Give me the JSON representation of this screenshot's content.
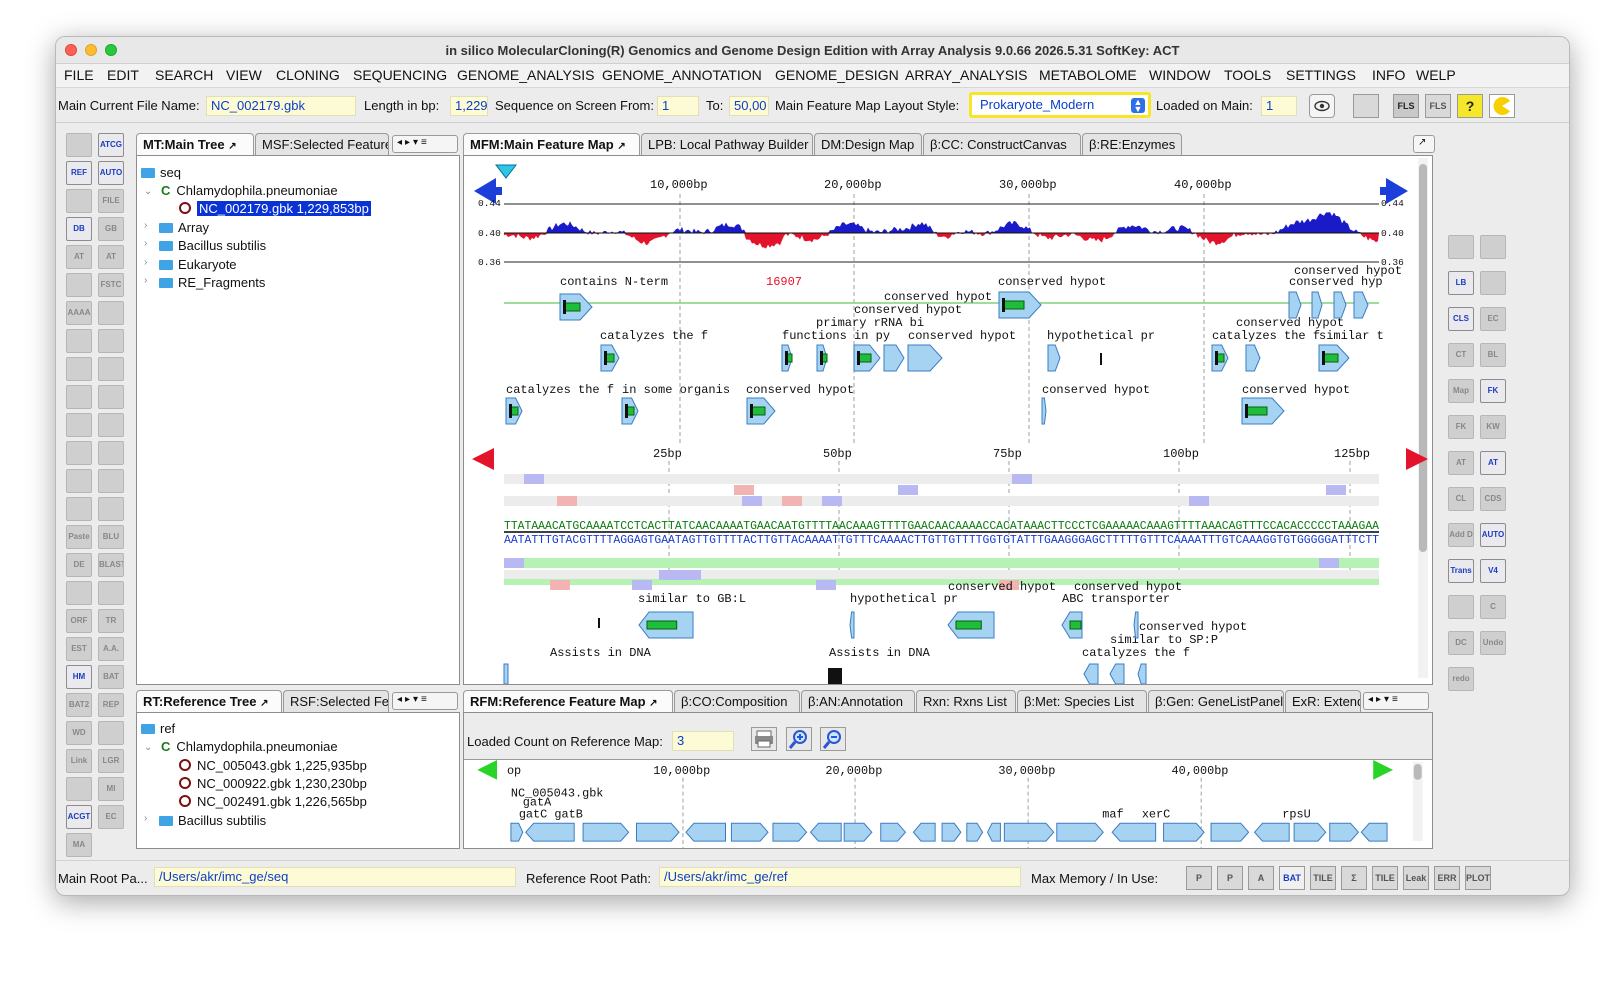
{
  "window": {
    "title": "in silico MolecularCloning(R) Genomics and Genome Design Edition with Array Analysis 9.0.66 2026.5.31 SoftKey: ACT"
  },
  "menu": [
    "FILE",
    "EDIT",
    "SEARCH",
    "VIEW",
    "CLONING",
    "SEQUENCING",
    "GENOME_ANALYSIS",
    "GENOME_ANNOTATION",
    "GENOME_DESIGN",
    "ARRAY_ANALYSIS",
    "METABOLOME",
    "WINDOW",
    "TOOLS",
    "SETTINGS",
    "INFO",
    "WELP"
  ],
  "infobar": {
    "file_label": "Main Current File Name:",
    "file_value": "NC_002179.gbk",
    "length_label": "Length in bp:",
    "length_value": "1,229",
    "from_label": "Sequence on Screen From:",
    "from_value": "1",
    "to_label": "To:",
    "to_value": "50,00",
    "layout_label": "Main Feature Map Layout Style:",
    "layout_value": "Prokaryote_Modern",
    "loaded_label": "Loaded on Main:",
    "loaded_value": "1",
    "btn_fls": "FLS",
    "btn_fls2": "FLS",
    "btn_help": "?"
  },
  "left_tools": [
    "",
    "ATCG",
    "REF",
    "AUTO",
    "",
    "FILE",
    "DB",
    "GB EMBL",
    "AT GC",
    "AT NEW",
    "",
    "FSTC",
    "AAAA",
    "",
    "",
    "",
    "",
    "",
    "",
    "",
    "",
    "",
    "",
    "",
    "",
    "",
    "",
    "",
    "Paste",
    "BLU",
    "DE PPP",
    "BLAST SEQ",
    "",
    "",
    "ORF",
    "TR",
    "EST",
    "A.A.",
    "HM",
    "BAT",
    "BAT2",
    "REP",
    "WD",
    "",
    "Link Map",
    "LGR Map",
    "",
    "MI Gene",
    "ACGT",
    "EC",
    "MA"
  ],
  "right_tools": [
    "",
    "",
    "LB",
    "",
    "CLS",
    "EC",
    "CT",
    "BL",
    "Map",
    "FK",
    "FK",
    "KW",
    "AT GC",
    "AT GC",
    "CL",
    "CDS",
    "Add D",
    "AUTO BAT",
    "Trans",
    "V4",
    "",
    "C",
    "DC",
    "Undo",
    "redo"
  ],
  "main_tree": {
    "tabs": [
      "MT:Main Tree",
      "MSF:Selected Feature"
    ],
    "nodes": [
      "seq",
      "Chlamydophila.pneumoniae",
      "NC_002179.gbk 1,229,853bp",
      "Array",
      "Bacillus subtilis",
      "Eukaryote",
      "RE_Fragments"
    ],
    "c_mark": "C"
  },
  "ref_tree": {
    "tabs": [
      "RT:Reference Tree",
      "RSF:Selected Fea"
    ],
    "nodes": [
      "ref",
      "Chlamydophila.pneumoniae",
      "NC_005043.gbk 1,225,935bp",
      "NC_000922.gbk 1,230,230bp",
      "NC_002491.gbk 1,226,565bp",
      "Bacillus subtilis"
    ],
    "c_mark": "C"
  },
  "main_map": {
    "tabs": [
      "MFM:Main Feature Map",
      "LPB: Local Pathway Builder",
      "DM:Design Map",
      "β:CC: ConstructCanvas",
      "β:RE:Enzymes"
    ],
    "ruler_top": [
      "10,000bp",
      "20,000bp",
      "30,000bp",
      "40,000bp"
    ],
    "gc_axis": [
      "0.44",
      "0.40",
      "0.36"
    ],
    "feature_labels": [
      "contains N-term",
      "16907",
      "conserved hypot",
      "conserved hypot",
      "conserved hypot",
      "primary rRNA bi",
      "conserved hypot",
      "conserved hypot",
      "catalyzes the f",
      "functions in py",
      "conserved hypot",
      "hypothetical pr",
      "conserved hypot",
      "catalyzes the f",
      "similar t",
      "catalyzes the f",
      "in some organis",
      "conserved hypot",
      "conserved hypot",
      "conserved hypot",
      "conserved hyp"
    ],
    "ruler_seq": [
      "25bp",
      "50bp",
      "75bp",
      "100bp",
      "125bp"
    ],
    "seq_top": "TTATAAACATGCAAAATCCTCACTTATCAACAAAATGAACAATGTTTTAACAAAGTTTTGAACAACAAAACCACATAAACTTCCCTCGAAAAACAAAGTTTTAAACAGTTTCCACACCCCCTAAAGAA",
    "seq_bottom": "AATATTTGTACGTTTTAGGAGTGAATAGTTGTTTTACTTGTTACAAAATTGTTTCAAAACTTGTTGTTTTGGTGTATTTGAAGGGAGCTTTTTGTTTCAAAATTTGTCAAAGGTGTGGGGGATTTCTT",
    "bottom_labels": [
      "similar to GB:L",
      "hypothetical pr",
      "conserved hypot",
      "conserved hypot",
      "ABC transporter",
      "conserved hypot",
      "similar to SP:P",
      "catalyzes the f",
      "conserved hypot",
      "Assists in DNA"
    ]
  },
  "ref_map": {
    "tabs": [
      "RFM:Reference Feature Map",
      "β:CO:Composition",
      "β:AN:Annotation",
      "Rxn: Rxns List",
      "β:Met: Species List",
      "β:Gen: GeneListPanel",
      "ExR: Extend"
    ],
    "loaded_label": "Loaded Count on Reference Map:",
    "loaded_value": "3",
    "ruler": [
      "op",
      "10,000bp",
      "20,000bp",
      "30,000bp",
      "40,000bp"
    ],
    "file_label": "NC_005043.gbk",
    "gene_labels": [
      "gatA",
      "gatC gatB",
      "maf",
      "xerC",
      "rpsU"
    ]
  },
  "status": {
    "main_root_label": "Main Root Pa...",
    "main_root_value": "/Users/akr/imc_ge/seq",
    "ref_root_label": "Reference Root Path:",
    "ref_root_value": "/Users/akr/imc_ge/ref",
    "memory_label": "Max Memory / In Use:",
    "buttons": [
      "P",
      "P",
      "A",
      "BAT",
      "TILE",
      "Σ",
      "TILE",
      "Leak",
      "ERR",
      "PLOT"
    ]
  },
  "colors": {
    "accent_blue": "#0b3dcb",
    "gc_positive": "#1a1ac9",
    "gc_negative": "#e3132c",
    "feature_fill": "#a7d3f2",
    "orf_green": "#1fbe3a",
    "highlight_field": "#fdfbd5"
  }
}
